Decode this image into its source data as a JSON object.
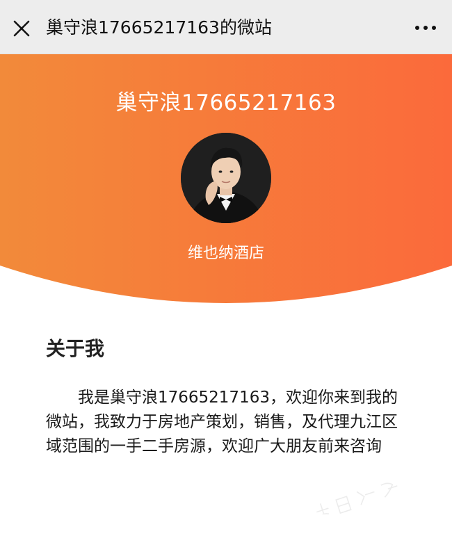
{
  "topbar": {
    "title": "巢守浪17665217163的微站",
    "close_icon": "close-icon",
    "more_icon": "more-horizontal-icon"
  },
  "banner": {
    "name": "巢守浪17665217163",
    "subtitle": "维也纳酒店",
    "avatar_icon": "profile-photo",
    "gradient_start": "#f28a3a",
    "gradient_end": "#fb6a3b"
  },
  "about": {
    "heading": "关于我",
    "body": "我是巢守浪17665217163，欢迎你来到我的微站，我致力于房地产策划，销售，及代理九江区域范围的一手二手房源，欢迎广大朋友前来咨询"
  },
  "colors": {
    "topbar_bg": "#ededed",
    "text_dark": "#1a1a1a",
    "white": "#ffffff"
  }
}
